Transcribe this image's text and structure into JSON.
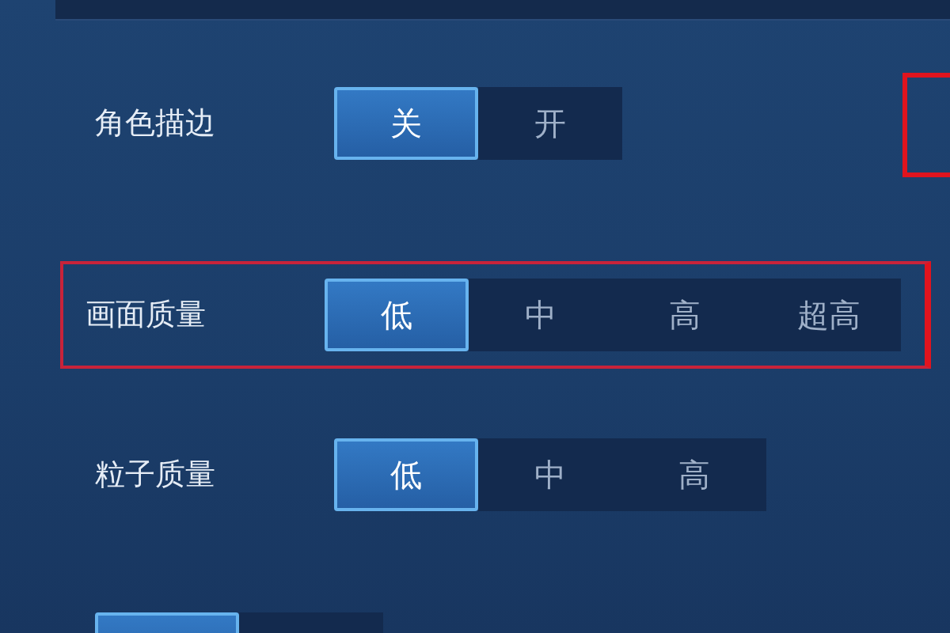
{
  "settings": [
    {
      "label": "角色描边",
      "highlighted": false,
      "options": [
        {
          "label": "关",
          "selected": true
        },
        {
          "label": "开",
          "selected": false
        }
      ]
    },
    {
      "label": "画面质量",
      "highlighted": true,
      "options": [
        {
          "label": "低",
          "selected": true
        },
        {
          "label": "中",
          "selected": false
        },
        {
          "label": "高",
          "selected": false
        },
        {
          "label": "超高",
          "selected": false
        }
      ]
    },
    {
      "label": "粒子质量",
      "highlighted": false,
      "options": [
        {
          "label": "低",
          "selected": true
        },
        {
          "label": "中",
          "selected": false
        },
        {
          "label": "高",
          "selected": false
        }
      ]
    }
  ],
  "cut_row": {
    "options": [
      {
        "selected": true
      },
      {
        "selected": false
      }
    ]
  }
}
